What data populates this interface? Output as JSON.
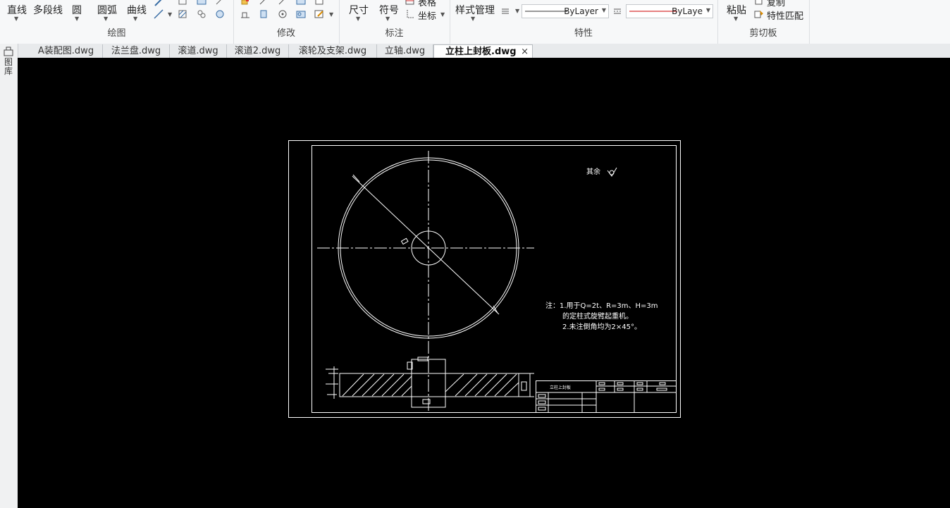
{
  "ribbon": {
    "draw": {
      "title": "绘图",
      "line": "直线",
      "polyline": "多段线",
      "circle": "圆",
      "arc": "圆弧",
      "curve": "曲线"
    },
    "modify": {
      "title": "修改"
    },
    "annotate": {
      "title": "标注",
      "dimension": "尺寸",
      "symbol": "符号",
      "table": "表格",
      "coordinate": "坐标"
    },
    "properties": {
      "title": "特性",
      "style_manager": "样式管理",
      "linetype_value": "ByLayer",
      "color_value": "ByLaye",
      "line_color": "#cc0000"
    },
    "clipboard": {
      "title": "剪切板",
      "paste": "粘贴",
      "copy": "复制",
      "match_properties": "特性匹配"
    }
  },
  "tabs": [
    {
      "label": "A装配图.dwg"
    },
    {
      "label": "法兰盘.dwg"
    },
    {
      "label": "滚道.dwg"
    },
    {
      "label": "滚道2.dwg"
    },
    {
      "label": "滚轮及支架.dwg"
    },
    {
      "label": "立轴.dwg"
    },
    {
      "label": "立柱上封板.dwg",
      "active": true
    }
  ],
  "tab_close_icon": "×",
  "left_panel": {
    "label": "图库"
  },
  "drawing": {
    "roughness_label": "其余",
    "notes": [
      "注：1.用于Q=2t、R=3m、H=3m",
      "的定柱式旋臂起重机。",
      "2.未注倒角均为2×45°。"
    ],
    "title_block_name": "立柱上封板"
  }
}
